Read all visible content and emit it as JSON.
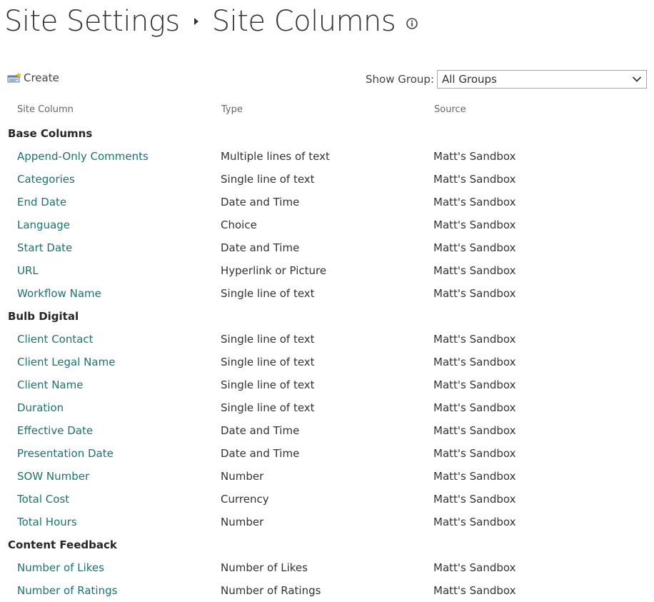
{
  "header": {
    "parent": "Site Settings",
    "current": "Site Columns"
  },
  "toolbar": {
    "create_label": "Create",
    "show_group_label": "Show Group:",
    "selected_group": "All Groups"
  },
  "table": {
    "columns": [
      "Site Column",
      "Type",
      "Source"
    ],
    "groups": [
      {
        "name": "Base Columns",
        "rows": [
          {
            "name": "Append-Only Comments",
            "type": "Multiple lines of text",
            "source": "Matt's Sandbox"
          },
          {
            "name": "Categories",
            "type": "Single line of text",
            "source": "Matt's Sandbox"
          },
          {
            "name": "End Date",
            "type": "Date and Time",
            "source": "Matt's Sandbox"
          },
          {
            "name": "Language",
            "type": "Choice",
            "source": "Matt's Sandbox"
          },
          {
            "name": "Start Date",
            "type": "Date and Time",
            "source": "Matt's Sandbox"
          },
          {
            "name": "URL",
            "type": "Hyperlink or Picture",
            "source": "Matt's Sandbox"
          },
          {
            "name": "Workflow Name",
            "type": "Single line of text",
            "source": "Matt's Sandbox"
          }
        ]
      },
      {
        "name": "Bulb Digital",
        "rows": [
          {
            "name": "Client Contact",
            "type": "Single line of text",
            "source": "Matt's Sandbox"
          },
          {
            "name": "Client Legal Name",
            "type": "Single line of text",
            "source": "Matt's Sandbox"
          },
          {
            "name": "Client Name",
            "type": "Single line of text",
            "source": "Matt's Sandbox"
          },
          {
            "name": "Duration",
            "type": "Single line of text",
            "source": "Matt's Sandbox"
          },
          {
            "name": "Effective Date",
            "type": "Date and Time",
            "source": "Matt's Sandbox"
          },
          {
            "name": "Presentation Date",
            "type": "Date and Time",
            "source": "Matt's Sandbox"
          },
          {
            "name": "SOW Number",
            "type": "Number",
            "source": "Matt's Sandbox"
          },
          {
            "name": "Total Cost",
            "type": "Currency",
            "source": "Matt's Sandbox"
          },
          {
            "name": "Total Hours",
            "type": "Number",
            "source": "Matt's Sandbox"
          }
        ]
      },
      {
        "name": "Content Feedback",
        "rows": [
          {
            "name": "Number of Likes",
            "type": "Number of Likes",
            "source": "Matt's Sandbox"
          },
          {
            "name": "Number of Ratings",
            "type": "Number of Ratings",
            "source": "Matt's Sandbox"
          }
        ]
      }
    ]
  },
  "icons": {
    "info": "info-icon",
    "create": "create-icon",
    "dropdown": "chevron-down-icon",
    "breadcrumb_separator": "caret-right-icon"
  },
  "colors": {
    "link": "#1a7474",
    "text": "#333333",
    "muted": "#666666",
    "border": "#a6a6a6"
  }
}
